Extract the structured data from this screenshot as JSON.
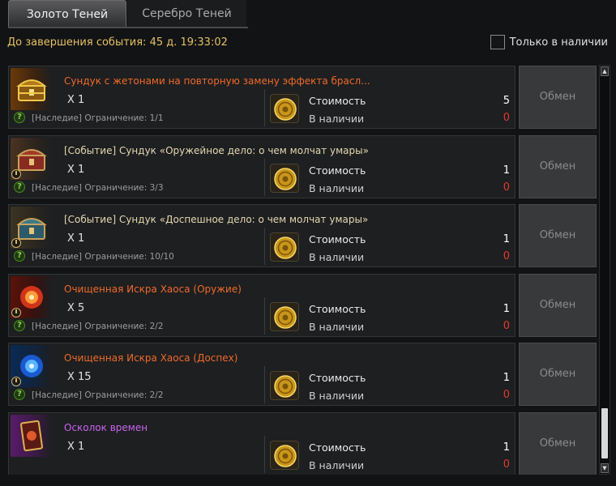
{
  "tabs": {
    "active": "Золото Теней",
    "inactive": "Серебро Теней"
  },
  "timer": "До завершения события: 45 д. 19:33:02",
  "filter": {
    "label": "Только в наличии",
    "checked": false
  },
  "labels": {
    "cost": "Стоимость",
    "have": "В наличии",
    "exchange": "Обмен"
  },
  "colors": {
    "gold": "#e7c163",
    "orange": "#f06a28",
    "beige": "#e6d7b0",
    "purple": "#cc64f0",
    "red": "#e23a2a"
  },
  "items": [
    {
      "name": "Сундук с жетонами на повторную замену эффекта брасл...",
      "name_color": "#f06a28",
      "qty": "X 1",
      "limit": "[Наследие] Ограничение: 1/1",
      "cost": "5",
      "have": "0",
      "icon": "gold-chest-icon",
      "timer": false
    },
    {
      "name": "[Событие] Сундук «Оружейное дело: о чем молчат умары»",
      "name_color": "#e6d7b0",
      "qty": "X 1",
      "limit": "[Наследие] Ограничение: 3/3",
      "cost": "1",
      "have": "0",
      "icon": "red-chest-icon",
      "timer": true
    },
    {
      "name": "[Событие] Сундук «Доспешное дело: о чем молчат умары»",
      "name_color": "#e6d7b0",
      "qty": "X 1",
      "limit": "[Наследие] Ограничение: 10/10",
      "cost": "1",
      "have": "0",
      "icon": "blue-chest-icon",
      "timer": true
    },
    {
      "name": "Очищенная Искра Хаоса (Оружие)",
      "name_color": "#f06a28",
      "qty": "X 5",
      "limit": "[Наследие] Ограничение: 2/2",
      "cost": "1",
      "have": "0",
      "icon": "red-spark-icon",
      "timer": true
    },
    {
      "name": "Очищенная Искра Хаоса (Доспех)",
      "name_color": "#f06a28",
      "qty": "X 15",
      "limit": "[Наследие] Ограничение: 2/2",
      "cost": "1",
      "have": "0",
      "icon": "blue-spark-icon",
      "timer": true
    },
    {
      "name": "Осколок времен",
      "name_color": "#cc64f0",
      "qty": "X 1",
      "limit": "",
      "cost": "1",
      "have": "0",
      "icon": "time-card-icon",
      "timer": false
    }
  ]
}
